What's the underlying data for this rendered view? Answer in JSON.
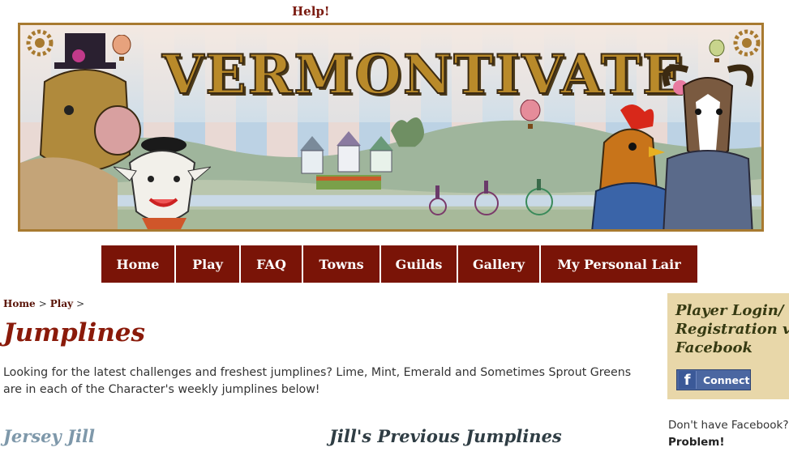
{
  "header": {
    "help_label": "Help!",
    "banner_title": "VERMONTIVATE"
  },
  "nav": {
    "items": [
      {
        "label": "Home"
      },
      {
        "label": "Play"
      },
      {
        "label": "FAQ"
      },
      {
        "label": "Towns"
      },
      {
        "label": "Guilds"
      },
      {
        "label": "Gallery"
      },
      {
        "label": "My Personal Lair"
      }
    ]
  },
  "breadcrumb": {
    "items": [
      "Home",
      "Play"
    ],
    "separator": ">"
  },
  "main": {
    "title": "Jumplines",
    "intro": "Looking for the latest challenges and freshest jumplines? Lime, Mint, Emerald and Sometimes Sprout Greens are in each of the Character's weekly jumplines below!",
    "character_name": "Jersey Jill",
    "previous_heading": "Jill's Previous Jumplines"
  },
  "sidebar": {
    "login_title_line1": "Player Login/",
    "login_title_line2": "Registration via",
    "login_title_line3": "Facebook",
    "connect_label": "Connect",
    "no_facebook_text": "Don't have Facebook?",
    "no_problem_text": "Problem!"
  },
  "colors": {
    "nav_bg": "#7a1407",
    "title_red": "#8a1a0a",
    "login_bg": "#e8d7a9",
    "facebook_blue": "#4b67a1"
  }
}
